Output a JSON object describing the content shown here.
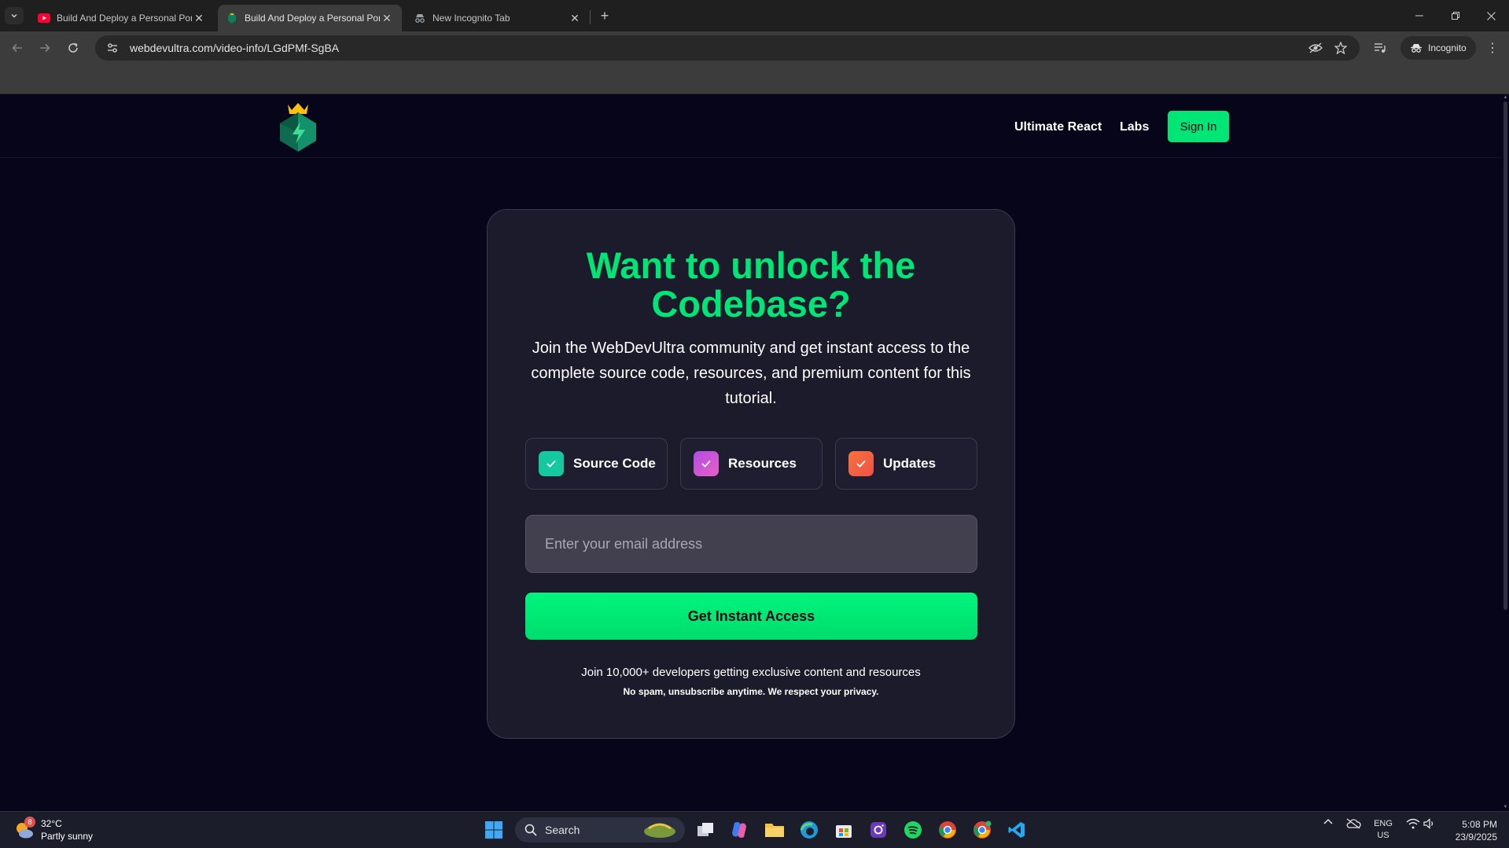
{
  "browser": {
    "tabs": [
      {
        "title": "Build And Deploy a Personal Portfolio",
        "active": false,
        "favicon": "youtube-icon"
      },
      {
        "title": "Build And Deploy a Personal Portfolio",
        "active": true,
        "favicon": "webdevultra-icon"
      },
      {
        "title": "New Incognito Tab",
        "active": false,
        "favicon": "incognito-icon"
      }
    ],
    "url": "webdevultra.com/video-info/LGdPMf-SgBA",
    "incognito_label": "Incognito"
  },
  "site": {
    "nav": {
      "ultimate_react": "Ultimate React",
      "labs": "Labs",
      "sign_in": "Sign In"
    },
    "card": {
      "title_line1": "Want to unlock the",
      "title_line2": "Codebase?",
      "lead": "Join the WebDevUltra community and get instant access to the complete source code, resources, and premium content for this tutorial.",
      "features": [
        {
          "label": "Source Code",
          "color": "#14c9a0"
        },
        {
          "label": "Resources",
          "color": "#c658e0"
        },
        {
          "label": "Updates",
          "color": "#f5743a"
        }
      ],
      "email_placeholder": "Enter your email address",
      "cta_label": "Get Instant Access",
      "footnote": "Join 10,000+ developers getting exclusive content and resources",
      "privacy": "No spam, unsubscribe anytime. We respect your privacy."
    },
    "colors": {
      "accent": "#00e676",
      "background": "#06051a",
      "card": "#1c1b2c"
    }
  },
  "taskbar": {
    "weather": {
      "temp": "32°C",
      "condition": "Partly sunny",
      "badge": "8"
    },
    "search_label": "Search",
    "language": {
      "line1": "ENG",
      "line2": "US"
    },
    "clock": {
      "time": "5:08 PM",
      "date": "23/9/2025"
    }
  }
}
